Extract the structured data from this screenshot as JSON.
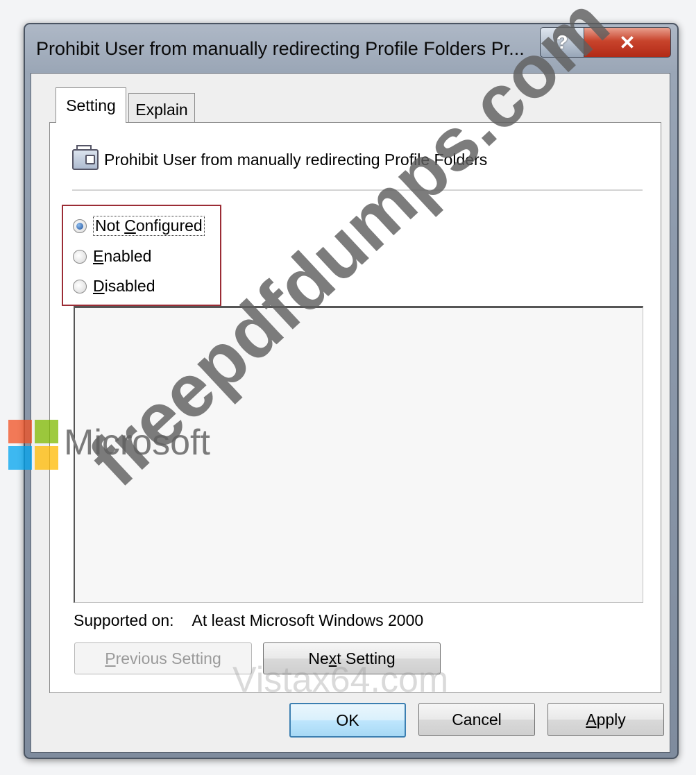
{
  "window": {
    "title": "Prohibit User from manually redirecting Profile Folders Pr...",
    "help_label": "?",
    "close_label": "✕"
  },
  "tabs": [
    {
      "label": "Setting",
      "selected": true
    },
    {
      "label": "Explain",
      "selected": false
    }
  ],
  "policy": {
    "icon": "policy-setting-icon",
    "name": "Prohibit User from manually redirecting Profile Folders"
  },
  "options": [
    {
      "label_pre": "Not ",
      "label_key": "C",
      "label_post": "onfigured",
      "checked": true
    },
    {
      "label_pre": "",
      "label_key": "E",
      "label_post": "nabled",
      "checked": false
    },
    {
      "label_pre": "",
      "label_key": "D",
      "label_post": "isabled",
      "checked": false
    }
  ],
  "supported": {
    "label": "Supported on:",
    "value": "At least Microsoft Windows 2000"
  },
  "nav_buttons": {
    "previous_key": "P",
    "previous_rest": "revious Setting",
    "next_pre": "Ne",
    "next_key": "x",
    "next_rest": "t Setting"
  },
  "dialog_buttons": {
    "ok": "OK",
    "cancel": "Cancel",
    "apply_key": "A",
    "apply_rest": "pply"
  },
  "watermarks": {
    "diagonal": "freepdfdumps.com",
    "brand": "Microsoft",
    "faint": "Vistax64.com"
  },
  "colors": {
    "highlight_border": "#9b2c35",
    "close_button": "#c8442c",
    "ok_button_border": "#3c7fb1"
  }
}
